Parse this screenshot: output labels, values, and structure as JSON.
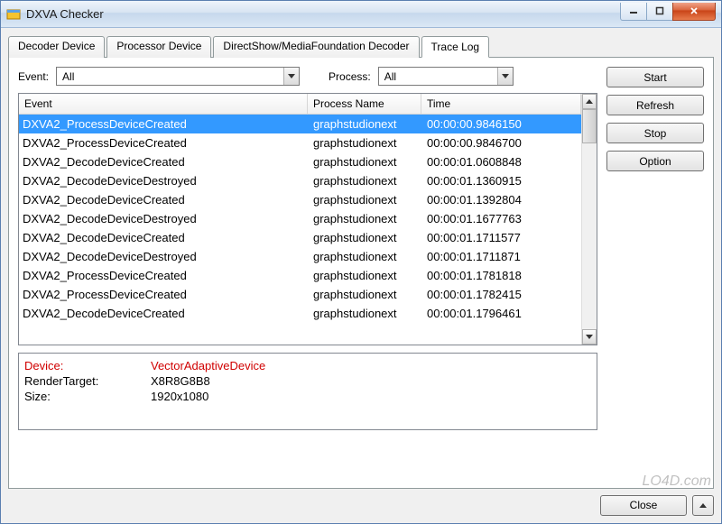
{
  "window": {
    "title": "DXVA Checker"
  },
  "tabs": [
    {
      "label": "Decoder Device",
      "active": false
    },
    {
      "label": "Processor Device",
      "active": false
    },
    {
      "label": "DirectShow/MediaFoundation Decoder",
      "active": false
    },
    {
      "label": "Trace Log",
      "active": true
    }
  ],
  "filters": {
    "event_label": "Event:",
    "event_value": "All",
    "process_label": "Process:",
    "process_value": "All"
  },
  "buttons": {
    "start": "Start",
    "refresh": "Refresh",
    "stop": "Stop",
    "option": "Option",
    "close": "Close"
  },
  "list": {
    "headers": {
      "event": "Event",
      "process": "Process Name",
      "time": "Time"
    },
    "rows": [
      {
        "event": "DXVA2_ProcessDeviceCreated",
        "process": "graphstudionext",
        "time": "00:00:00.9846150",
        "selected": true
      },
      {
        "event": "DXVA2_ProcessDeviceCreated",
        "process": "graphstudionext",
        "time": "00:00:00.9846700"
      },
      {
        "event": "DXVA2_DecodeDeviceCreated",
        "process": "graphstudionext",
        "time": "00:00:01.0608848"
      },
      {
        "event": "DXVA2_DecodeDeviceDestroyed",
        "process": "graphstudionext",
        "time": "00:00:01.1360915"
      },
      {
        "event": "DXVA2_DecodeDeviceCreated",
        "process": "graphstudionext",
        "time": "00:00:01.1392804"
      },
      {
        "event": "DXVA2_DecodeDeviceDestroyed",
        "process": "graphstudionext",
        "time": "00:00:01.1677763"
      },
      {
        "event": "DXVA2_DecodeDeviceCreated",
        "process": "graphstudionext",
        "time": "00:00:01.1711577"
      },
      {
        "event": "DXVA2_DecodeDeviceDestroyed",
        "process": "graphstudionext",
        "time": "00:00:01.1711871"
      },
      {
        "event": "DXVA2_ProcessDeviceCreated",
        "process": "graphstudionext",
        "time": "00:00:01.1781818"
      },
      {
        "event": "DXVA2_ProcessDeviceCreated",
        "process": "graphstudionext",
        "time": "00:00:01.1782415"
      },
      {
        "event": "DXVA2_DecodeDeviceCreated",
        "process": "graphstudionext",
        "time": "00:00:01.1796461"
      }
    ]
  },
  "details": {
    "device_label": "Device:",
    "device_value": "VectorAdaptiveDevice",
    "render_label": "RenderTarget:",
    "render_value": "X8R8G8B8",
    "size_label": "Size:",
    "size_value": "1920x1080"
  },
  "watermark": "LO4D.com"
}
